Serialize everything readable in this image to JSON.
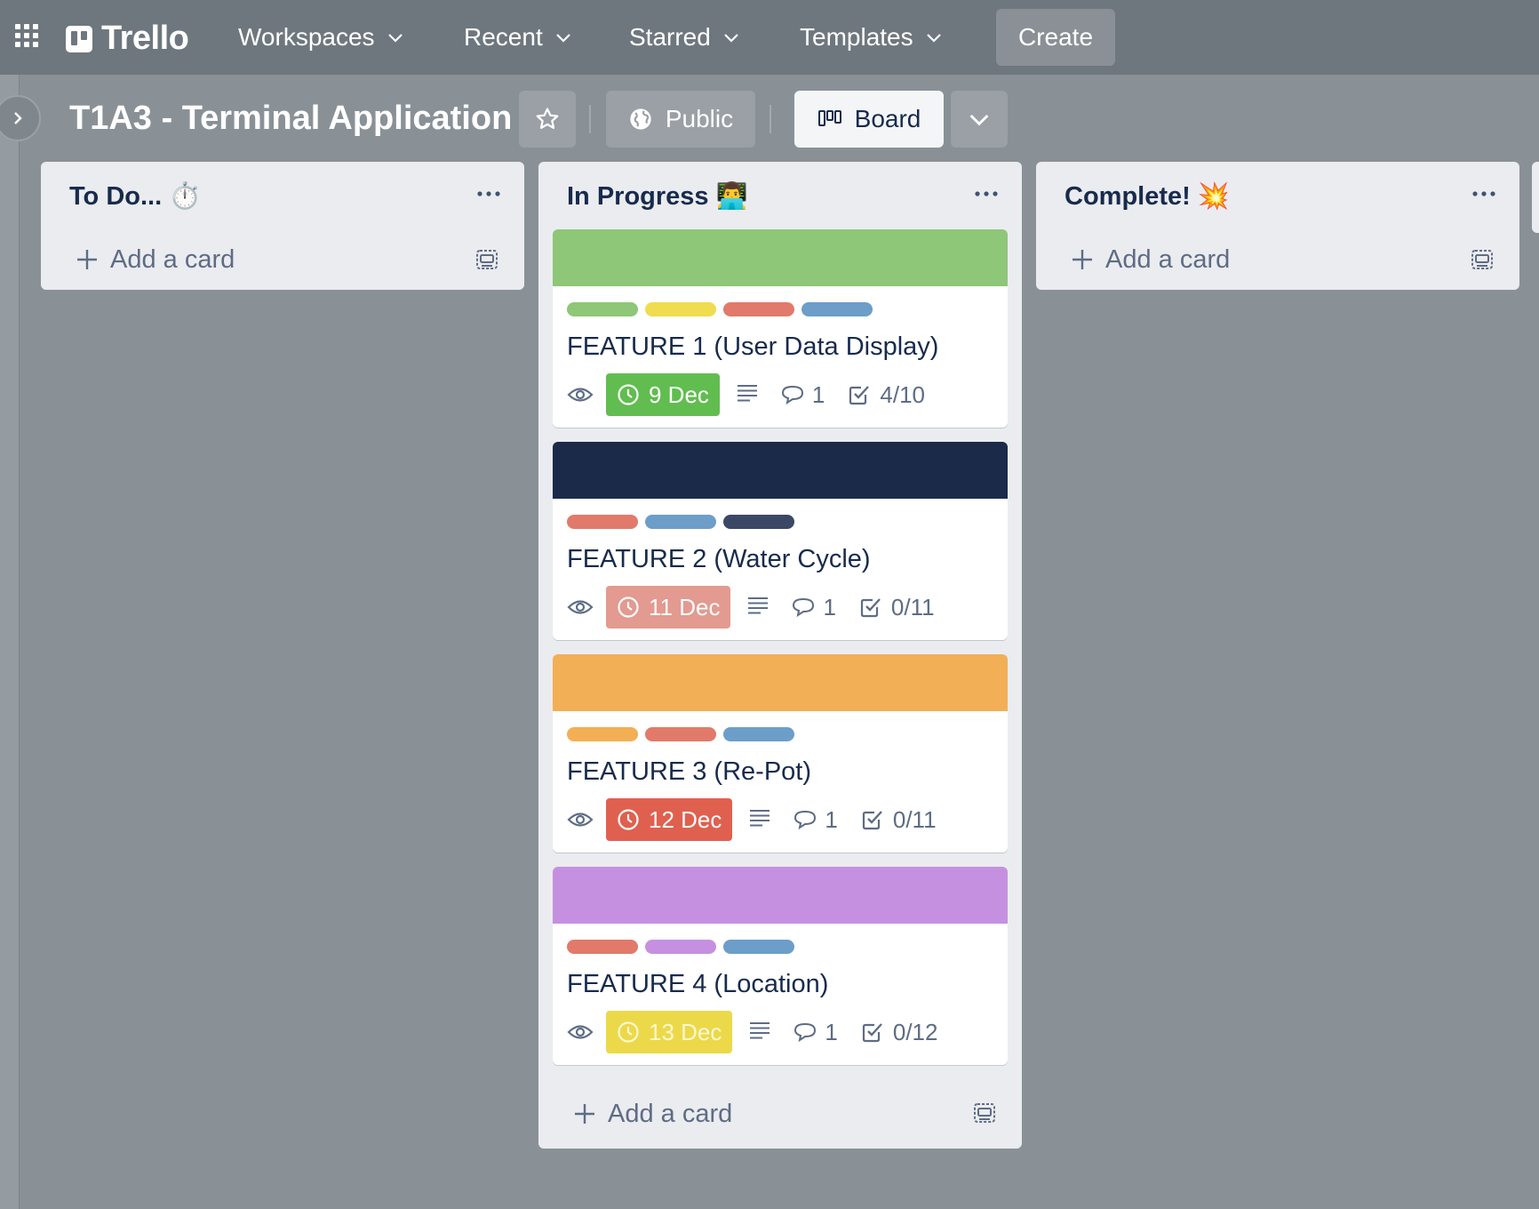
{
  "nav": {
    "brand": "Trello",
    "items": [
      "Workspaces",
      "Recent",
      "Starred",
      "Templates"
    ],
    "create_label": "Create"
  },
  "board": {
    "title": "T1A3 - Terminal Application",
    "visibility_label": "Public",
    "view_label": "Board"
  },
  "lists": [
    {
      "title": "To Do... ⏱️",
      "add_card_label": "Add a card",
      "cards": []
    },
    {
      "title": "In Progress 👨‍💻",
      "add_card_label": "Add a card",
      "cards": [
        {
          "title": "FEATURE 1 (User Data Display)",
          "cover_color": "#8dc777",
          "labels": [
            "#8dc777",
            "#efdc4f",
            "#e17a6a",
            "#6c9ec9"
          ],
          "due": "9 Dec",
          "due_color": "#61bd4f",
          "due_text_color": "#ffffff",
          "comments": "1",
          "checklist": "4/10"
        },
        {
          "title": "FEATURE 2 (Water Cycle)",
          "cover_color": "#1c2a4a",
          "labels": [
            "#e17a6a",
            "#6c9ec9",
            "#3a4866"
          ],
          "due": "11 Dec",
          "due_color": "#e39a90",
          "due_text_color": "#ffffff",
          "comments": "1",
          "checklist": "0/11"
        },
        {
          "title": "FEATURE 3 (Re-Pot)",
          "cover_color": "#f2af55",
          "labels": [
            "#f2af55",
            "#e17a6a",
            "#6c9ec9"
          ],
          "due": "12 Dec",
          "due_color": "#e0604f",
          "due_text_color": "#ffffff",
          "comments": "1",
          "checklist": "0/11"
        },
        {
          "title": "FEATURE 4 (Location)",
          "cover_color": "#c690e0",
          "labels": [
            "#e17a6a",
            "#c690e0",
            "#6c9ec9"
          ],
          "due": "13 Dec",
          "due_color": "#ecd94a",
          "due_text_color": "#fdf7d0",
          "comments": "1",
          "checklist": "0/12"
        }
      ]
    },
    {
      "title": "Complete! 💥",
      "add_card_label": "Add a card",
      "cards": []
    }
  ]
}
